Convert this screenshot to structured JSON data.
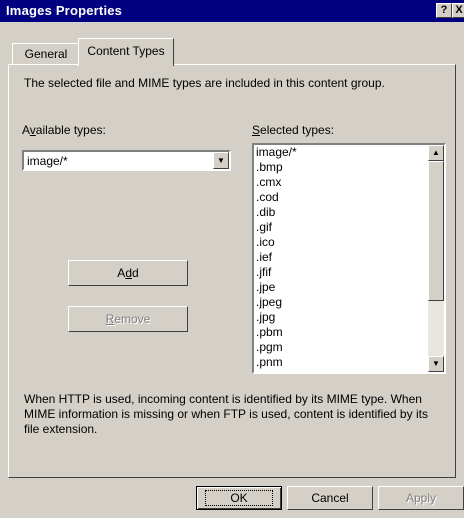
{
  "window": {
    "title": "Images Properties",
    "help_label": "?",
    "close_label": "X"
  },
  "tabs": [
    {
      "label": "General",
      "active": false
    },
    {
      "label": "Content Types",
      "active": true
    }
  ],
  "content": {
    "description": "The selected file and MIME types are included in this content group.",
    "available_label_pre": "A",
    "available_label_key": "v",
    "available_label_post": "ailable types:",
    "available_value": "image/*",
    "selected_label_key": "S",
    "selected_label_post": "elected types:",
    "selected_items": [
      ".bmp",
      ".cmx",
      ".cod",
      ".dib",
      ".gif",
      ".ico",
      ".ief",
      ".jfif",
      ".jpe",
      ".jpeg",
      ".jpg",
      ".pbm",
      ".pgm",
      ".pnm"
    ],
    "selected_first": "image/*",
    "add_pre": "A",
    "add_key": "d",
    "add_post": "d",
    "remove_key": "R",
    "remove_post": "emove",
    "note": "When HTTP is used, incoming content is identified by its MIME type. When MIME information is missing or when FTP is used, content is identified by its file extension."
  },
  "footer": {
    "ok": "OK",
    "cancel": "Cancel",
    "apply": "Apply"
  },
  "colors": {
    "title_bar": "#000080",
    "dialog_bg": "#d4d0c8"
  }
}
